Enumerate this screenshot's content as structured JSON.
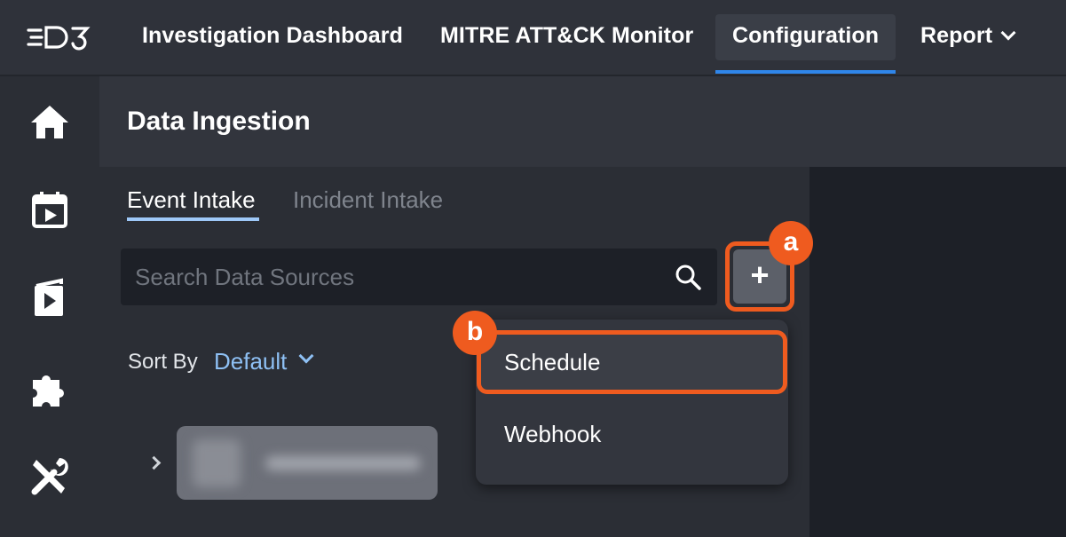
{
  "app": {
    "logo_text": "D3"
  },
  "nav": {
    "items": [
      {
        "label": "Investigation Dashboard"
      },
      {
        "label": "MITRE ATT&CK Monitor"
      },
      {
        "label": "Configuration"
      },
      {
        "label": "Report"
      }
    ],
    "active": "Configuration"
  },
  "sidebar": {
    "icons": [
      "home-icon",
      "calendar-play-icon",
      "playbook-icon",
      "puzzle-icon",
      "tools-icon"
    ]
  },
  "page": {
    "title": "Data Ingestion"
  },
  "tabs": [
    {
      "label": "Event Intake"
    },
    {
      "label": "Incident Intake"
    }
  ],
  "search": {
    "placeholder": "Search Data Sources",
    "value": ""
  },
  "add_button": {
    "label": "+"
  },
  "sort": {
    "label": "Sort By",
    "value": "Default"
  },
  "annotations": {
    "a": "a",
    "b": "b"
  },
  "menu": {
    "items": [
      {
        "label": "Schedule"
      },
      {
        "label": "Webhook"
      }
    ]
  },
  "colors": {
    "accent": "#2f86ea",
    "highlight": "#ef5b1f",
    "link": "#8ec0f4",
    "tab_underline": "#9ec8f8"
  }
}
